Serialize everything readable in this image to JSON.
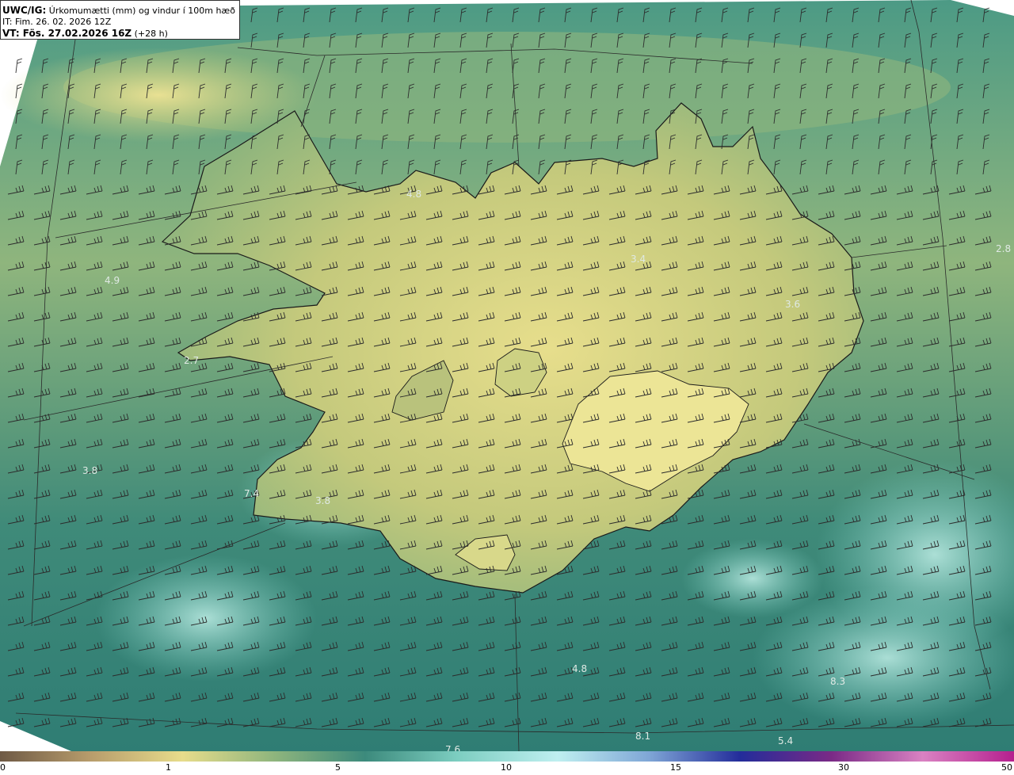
{
  "header": {
    "model": "UWC/IG:",
    "title": "Úrkomumætti (mm) og vindur í 100m hæð",
    "it_line": "IT: Fim. 26. 02. 2026 12Z",
    "vt_label": "VT: Fös. 27.02.2026 16Z",
    "vt_suffix": " (+28 h)"
  },
  "value_labels": [
    "4.8",
    "4.9",
    "3.4",
    "3.6",
    "2.8",
    "2.7",
    "3.8",
    "7.4",
    "3.8",
    "4.8",
    "8.1",
    "5.4",
    "7.6",
    "8.3"
  ],
  "colorbar": {
    "ticks": [
      "0",
      "1",
      "5",
      "10",
      "15",
      "30",
      "50"
    ],
    "colors": [
      "#6f5a45",
      "#b89d6c",
      "#e7dc8b",
      "#8fb57d",
      "#3c8a7c",
      "#7ccdc0",
      "#bfeff0",
      "#7fa6d6",
      "#232c9a",
      "#7a2a86",
      "#d982c2",
      "#b51f8e"
    ]
  },
  "style": {
    "land_color": "#d6d47f",
    "sea_color": "#3f8a79",
    "coast_color": "#1a1a1a",
    "barb_color": "#2c2c2c",
    "label_color": "#dfe9e4"
  }
}
